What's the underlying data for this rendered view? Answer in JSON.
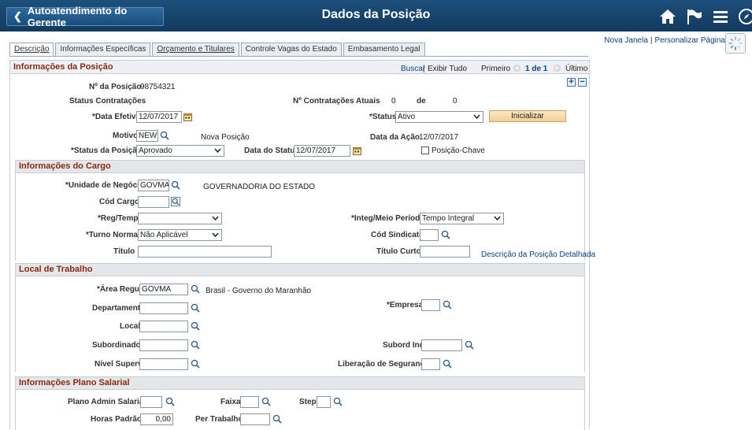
{
  "header": {
    "back_label": "Autoatendimento do Gerente",
    "title": "Dados da Posição",
    "icons": [
      "home-icon",
      "flag-icon",
      "menu-icon",
      "compass-icon"
    ]
  },
  "top_links": {
    "new_window": "Nova Janela",
    "personalize": "Personalizar Página"
  },
  "tabs": [
    {
      "label": "Descrição"
    },
    {
      "label": "Informações Específicas"
    },
    {
      "label": "Orçamento e Titulares"
    },
    {
      "label": "Controle Vagas do Estado"
    },
    {
      "label": "Embasamento Legal"
    }
  ],
  "section_position": {
    "title": "Informações da Posição",
    "find": "Buscar",
    "view_all": "Exibir Tudo",
    "first": "Primeiro",
    "count": "1 de 1",
    "last": "Último",
    "position_number_label": "Nº da Posição",
    "position_number": "98754321",
    "hiring_status_label": "Status Contratações",
    "current_hires_label": "Nº Contratações Atuais",
    "current_hires": "0",
    "of_label": "de",
    "max_hires": "0",
    "eff_date_label": "*Data Efetiva",
    "eff_date": "12/07/2017",
    "status_label": "*Status",
    "status_value": "Ativo",
    "init_button": "Inicializar",
    "reason_label": "Motivo",
    "reason_value": "NEW",
    "reason_desc": "Nova Posição",
    "action_date_label": "Data da Ação",
    "action_date": "12/07/2017",
    "pos_status_label": "*Status da Posição",
    "pos_status_value": "Aprovado",
    "status_date_label": "Data do Status",
    "status_date": "12/07/2017",
    "key_position_label": "Posição-Chave"
  },
  "section_job": {
    "title": "Informações do Cargo",
    "business_unit_label": "*Unidade de Negócio",
    "business_unit": "GOVMA",
    "business_unit_desc": "GOVERNADORIA DO ESTADO",
    "job_code_label": "Cód Cargo",
    "job_code": "",
    "reg_temp_label": "*Reg/Temp",
    "reg_temp_value": "",
    "full_part_label": "*Integ/Meio Período",
    "full_part_value": "Tempo Integral",
    "shift_label": "*Turno Normal",
    "shift_value": "Não Aplicável",
    "union_label": "Cód Sindicato",
    "union_value": "",
    "title_label": "Título",
    "title_value": "",
    "short_title_label": "Título Curto",
    "short_title_value": "",
    "detail_link": "Descrição da Posição Detalhada"
  },
  "section_work": {
    "title": "Local de Trabalho",
    "reg_region_label": "*Área Regul",
    "reg_region": "GOVMA",
    "reg_region_desc": "Brasil - Governo do Maranhão",
    "department_label": "Departamento",
    "company_label": "*Empresa",
    "location_label": "Local",
    "reports_to_label": "Subordinados",
    "dotted_label": "Subord Ind",
    "supv_level_label": "Nível Superv",
    "security_label": "Liberação de Segurança"
  },
  "section_salary": {
    "title": "Informações Plano Salarial",
    "sal_plan_label": "Plano Admin Salarial",
    "grade_label": "Faixa",
    "step_label": "Step",
    "std_hours_label": "Horas Padrão",
    "std_hours": "0,00",
    "work_period_label": "Per Trabalho"
  }
}
